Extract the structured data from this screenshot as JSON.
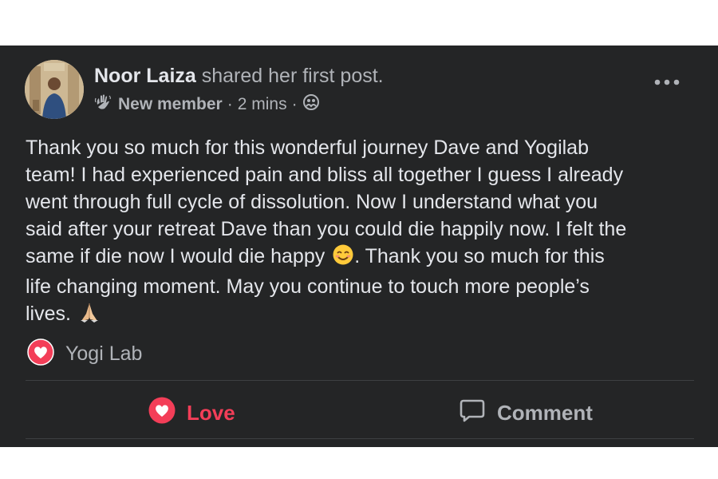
{
  "post": {
    "author": "Noor Laiza",
    "action_text": "shared her first post.",
    "badge": "New member",
    "time": "2 mins",
    "audience_icon": "group-icon",
    "more_icon": "more-icon",
    "body_lines": [
      "Thank you so much for this wonderful journey Dave and Yogilab",
      "team! I had experienced pain and bliss all together I guess I already",
      "went through full cycle of dissolution. Now I understand what you",
      "said after your retreat Dave than you could die happily now. I felt the",
      "same if die now I would die happy",
      ". Thank you so much for this",
      "life changing moment. May you continue to touch more people’s",
      "lives."
    ]
  },
  "reactions": {
    "icon": "heart-reaction-icon",
    "names": "Yogi Lab"
  },
  "actions": {
    "love_label": "Love",
    "comment_label": "Comment"
  },
  "colors": {
    "card_bg": "#242526",
    "primary_text": "#e4e6eb",
    "secondary_text": "#b0b3b8",
    "love": "#f33e58"
  }
}
